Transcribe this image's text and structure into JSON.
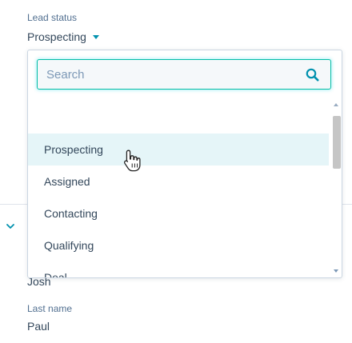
{
  "lead_status": {
    "label": "Lead status",
    "selected": "Prospecting"
  },
  "dropdown": {
    "search_placeholder": "Search",
    "search_value": "",
    "options": [
      {
        "label": "Prospecting",
        "hovered": true
      },
      {
        "label": "Assigned",
        "hovered": false
      },
      {
        "label": "Contacting",
        "hovered": false
      },
      {
        "label": "Qualifying",
        "hovered": false
      },
      {
        "label": "Deal",
        "hovered": false
      }
    ]
  },
  "first_name": {
    "value": "Josh"
  },
  "last_name": {
    "label": "Last name",
    "value": "Paul"
  },
  "icons": {
    "search": "search-icon",
    "caret": "caret-down-icon",
    "section_toggle": "chevron-down-icon",
    "pointer": "hand-pointer-icon"
  },
  "colors": {
    "accent": "#0091ae",
    "focus_border": "#00bda5",
    "hover_row": "#e5f5f8",
    "text": "#33475b",
    "muted_text": "#516f90"
  }
}
